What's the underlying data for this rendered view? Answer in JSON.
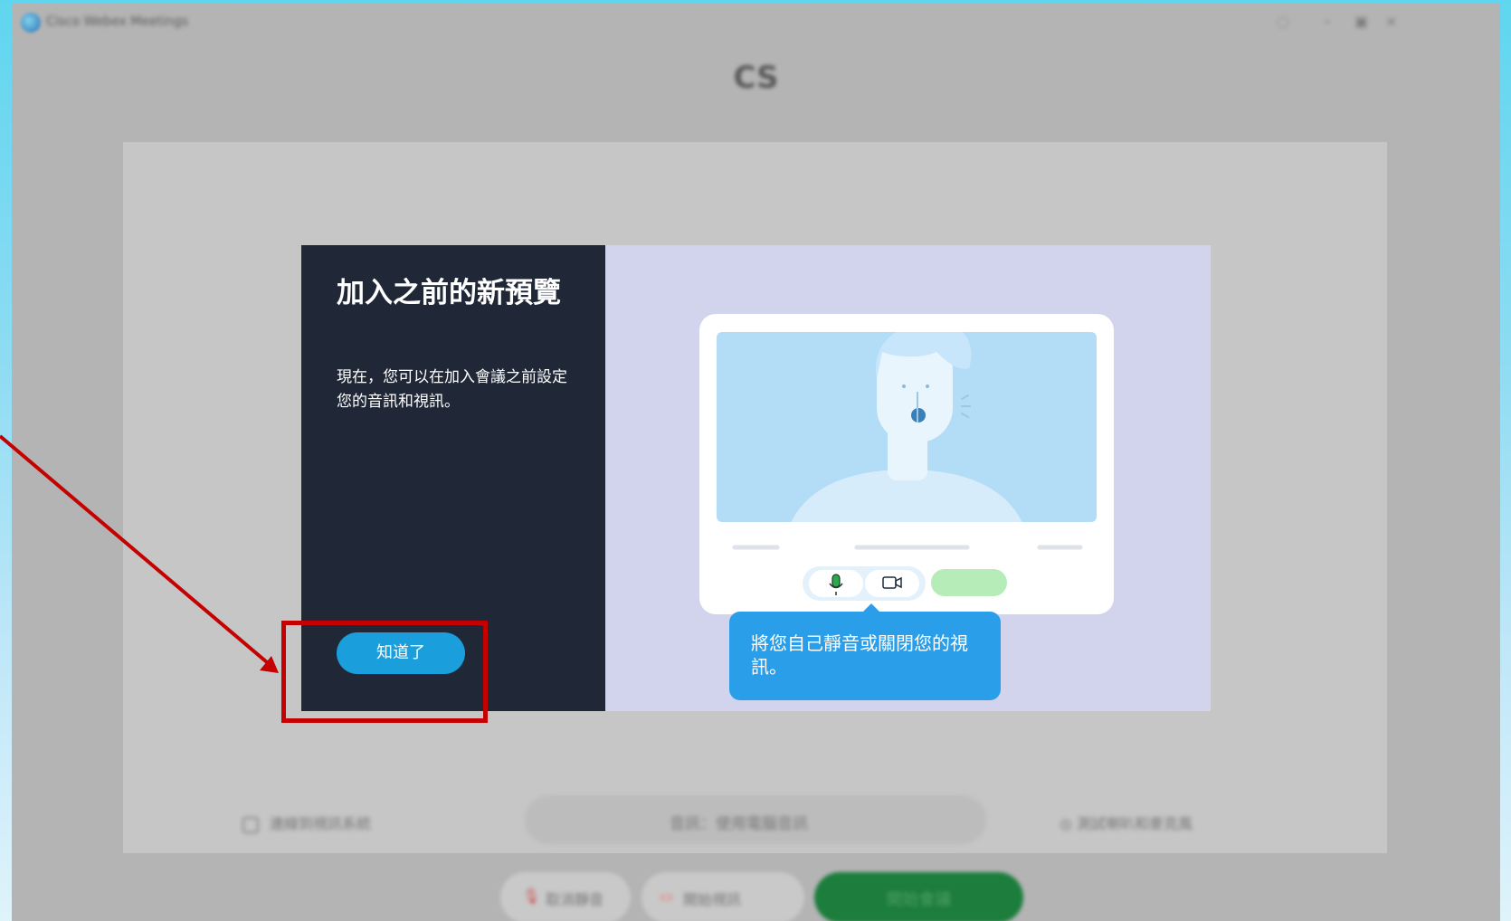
{
  "window": {
    "title": "Cisco Webex Meetings"
  },
  "meeting": {
    "host_initials": "CS"
  },
  "bottom_options": {
    "left_checkbox": "連線到視訊系統",
    "audio_pill": "音訊：使用電腦音訊",
    "right_option": "測試喇叭和麥克風"
  },
  "controls": {
    "mute": "取消靜音",
    "video": "開始視訊",
    "start": "開始會議"
  },
  "dialog": {
    "title": "加入之前的新預覽",
    "description": "現在，您可以在加入會議之前設定您的音訊和視訊。",
    "got_it": "知道了",
    "tooltip": "將您自己靜音或關閉您的視訊。"
  },
  "colors": {
    "dialog_dark": "#202838",
    "dialog_light": "#d1d4ec",
    "accent_blue": "#1b9fdc",
    "highlight_red": "#c40000",
    "start_green": "#1c7d3c"
  },
  "icons": [
    "app-logo-icon",
    "help-icon",
    "minimize-icon",
    "maximize-icon",
    "close-icon",
    "microphone-icon",
    "camera-icon",
    "speaker-icon"
  ]
}
